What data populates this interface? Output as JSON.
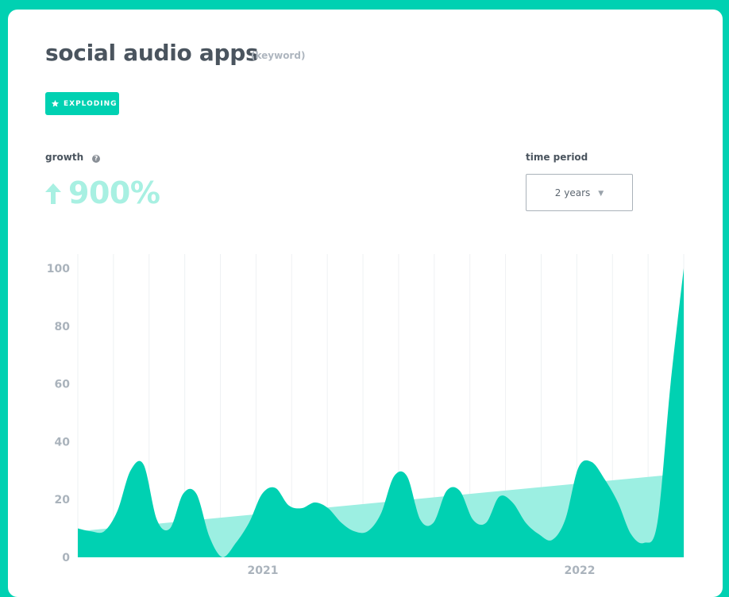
{
  "header": {
    "title": "social audio apps",
    "tag": "(keyword)"
  },
  "badge": {
    "label": "EXPLODING",
    "icon": "star-icon",
    "color": "#00d1b2"
  },
  "growth": {
    "label": "growth",
    "help_icon": "question-circle-icon",
    "arrow_icon": "arrow-up-icon",
    "value": "900%"
  },
  "time_period": {
    "label": "time period",
    "selected": "2 years",
    "caret_icon": "caret-down-icon"
  },
  "colors": {
    "background": "#00d1b2",
    "series_fill": "#00d1b2",
    "trend_fill": "#9cefe2",
    "growth_text": "#a8f0e2"
  },
  "chart_data": {
    "type": "area",
    "title": "",
    "xlabel": "",
    "ylabel": "",
    "ylim": [
      0,
      100
    ],
    "yticks": [
      "0",
      "20",
      "40",
      "60",
      "80",
      "100"
    ],
    "xticks": [
      "2021",
      "2022"
    ],
    "grid": true,
    "series": [
      {
        "values": [
          10,
          9,
          9,
          16,
          30,
          32,
          13,
          10,
          22,
          22,
          7,
          0,
          5,
          12,
          22,
          24,
          18,
          17,
          19,
          17,
          12,
          9,
          9,
          15,
          28,
          28,
          13,
          12,
          23,
          23,
          13,
          12,
          21,
          19,
          12,
          8,
          6,
          13,
          31,
          33,
          27,
          19,
          8,
          5,
          12,
          60,
          100
        ]
      }
    ],
    "trend": {
      "start": 9,
      "end": 29
    }
  }
}
